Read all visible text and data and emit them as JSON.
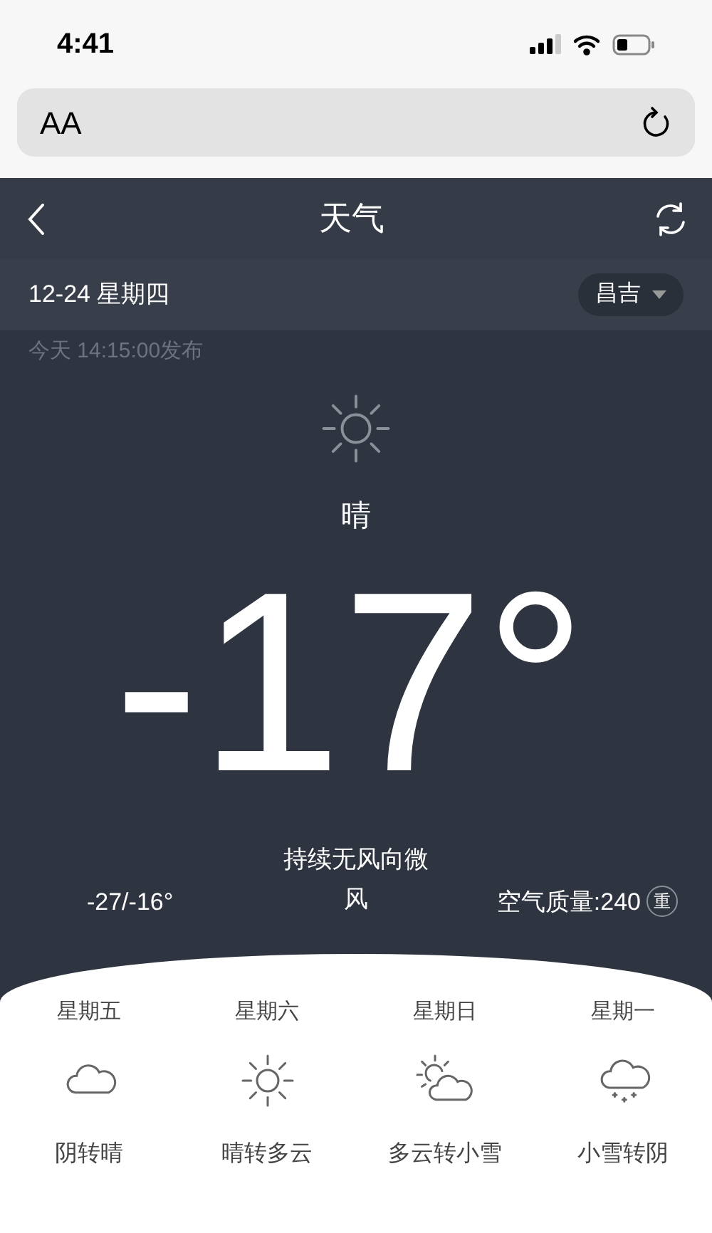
{
  "status_bar": {
    "time": "4:41"
  },
  "address_bar": {
    "text_size": "AA"
  },
  "nav": {
    "title": "天气"
  },
  "date": "12-24 星期四",
  "city": "昌吉",
  "published": "今天 14:15:00发布",
  "current": {
    "condition": "晴",
    "temperature": "-17°",
    "range": "-27/-16°",
    "wind": "持续无风向微风",
    "air_quality": "空气质量:240",
    "air_level": "重"
  },
  "forecast": [
    {
      "day": "星期五",
      "kind": "cloudy",
      "text": "阴转晴"
    },
    {
      "day": "星期六",
      "kind": "sunny",
      "text": "晴转多云"
    },
    {
      "day": "星期日",
      "kind": "partly",
      "text": "多云转小雪"
    },
    {
      "day": "星期一",
      "kind": "snow",
      "text": "小雪转阴"
    }
  ]
}
